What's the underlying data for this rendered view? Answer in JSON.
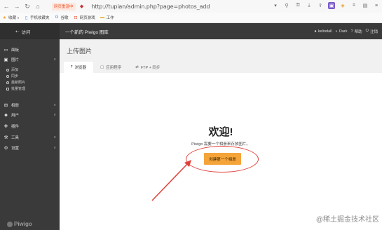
{
  "browser": {
    "tab_chip": "网页重温中",
    "url": "http://tupian/admin.php?page=photos_add",
    "bookmarks": [
      {
        "label": "收藏",
        "icon": "star-icon"
      },
      {
        "label": "手机收藏夹",
        "icon": "mobile-icon"
      },
      {
        "label": "谷歌",
        "icon": "google-icon"
      },
      {
        "label": "网页游戏",
        "icon": "game-icon"
      },
      {
        "label": "工作",
        "icon": "folder-icon"
      }
    ]
  },
  "sidebar": {
    "visit_label": "访问",
    "menu": [
      {
        "label": "面板",
        "icon": "monitor-icon",
        "has_chevron": false
      },
      {
        "label": "图片",
        "icon": "image-icon",
        "has_chevron": true
      },
      {
        "label": "相册",
        "icon": "album-icon",
        "has_chevron": true
      },
      {
        "label": "用户",
        "icon": "users-icon",
        "has_chevron": true
      },
      {
        "label": "插件",
        "icon": "puzzle-icon",
        "has_chevron": false
      },
      {
        "label": "工具",
        "icon": "wrench-icon",
        "has_chevron": true
      },
      {
        "label": "设置",
        "icon": "gear-icon",
        "has_chevron": true
      }
    ],
    "submenu": [
      "添加",
      "同步",
      "最新照片",
      "批量管理"
    ],
    "logo_text": "Piwigo"
  },
  "topbar": {
    "title": "一个新的 Piwigo 图库",
    "user": "kelindall",
    "theme": "Dark",
    "help": "帮助",
    "logout": "注销"
  },
  "main": {
    "page_title": "上传图片",
    "tabs": [
      {
        "label": "浏览器",
        "active": true
      },
      {
        "label": "应用程序",
        "active": false
      },
      {
        "label": "FTP + 同步",
        "active": false
      }
    ],
    "welcome": "欢迎!",
    "welcome_sub": "Piwigo 需要一个相册来存放图片。",
    "create_button": "创建第一个相册"
  },
  "watermark": "@稀土掘金技术社区",
  "colors": {
    "sidebar_bg": "#3a3a3a",
    "accent_button": "#f5a43a",
    "annotation_red": "#e0403a"
  }
}
